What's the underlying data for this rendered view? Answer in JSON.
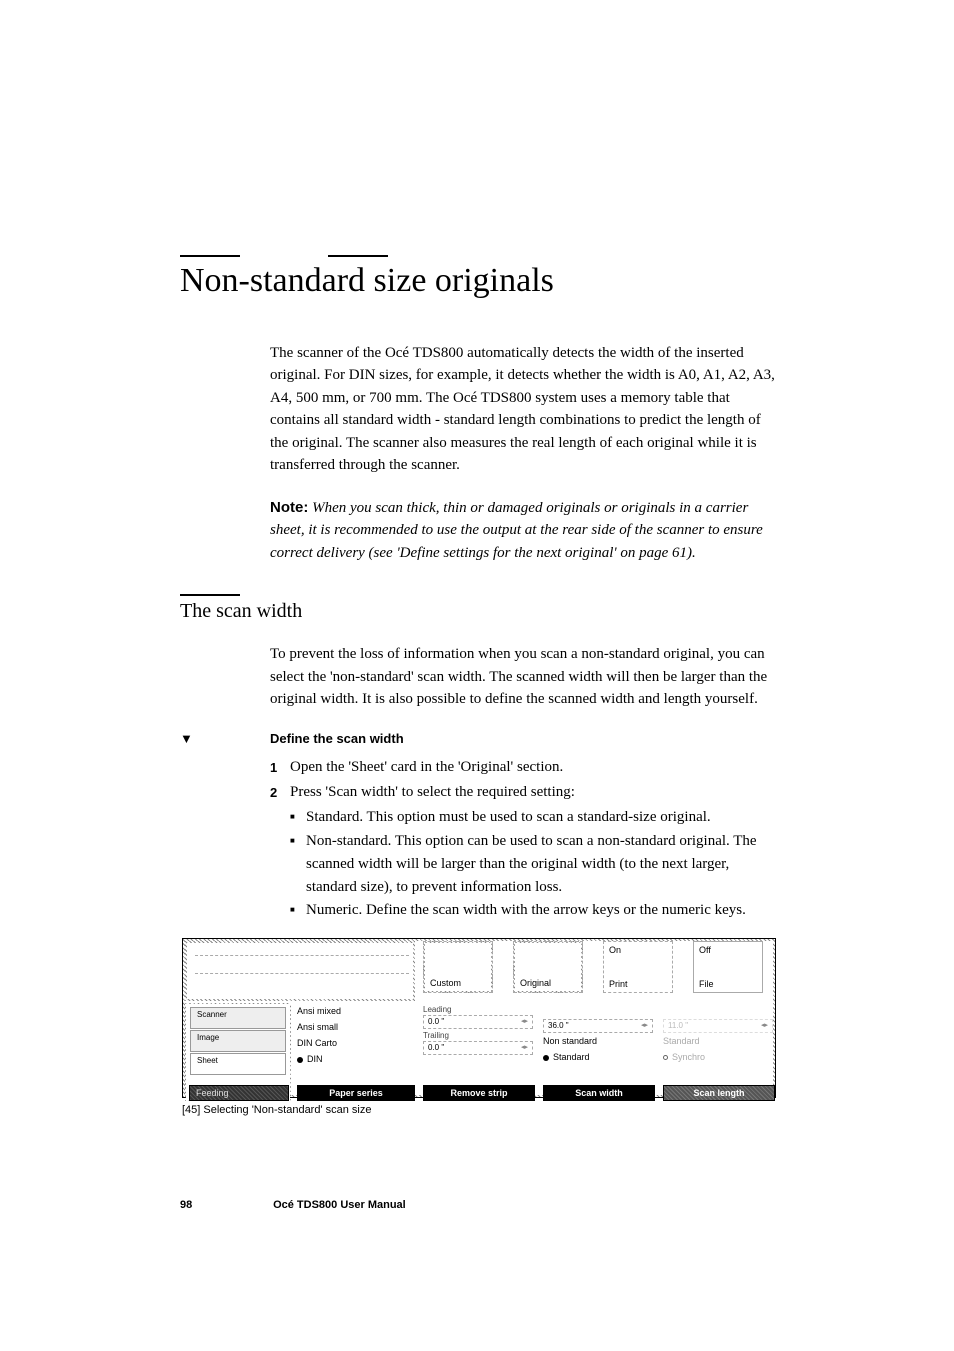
{
  "title": "Non-standard size originals",
  "intro": "The scanner of the Océ TDS800 automatically detects the width of the inserted original. For DIN sizes, for example, it detects whether the width is A0, A1, A2, A3, A4, 500 mm, or 700 mm. The Océ TDS800 system uses a memory table that contains all standard width - standard length combinations to predict the length of the original. The scanner also measures the real length of each original while it is transferred through the scanner.",
  "note_label": "Note:",
  "note_text": " When you scan thick, thin or damaged originals or originals in a carrier sheet, it is recommended to use the output at the rear side of the scanner to ensure correct delivery (see 'Define settings for the next original' on page 61).",
  "subsection_title": "The scan width",
  "subsection_intro": "To prevent the loss of information when you scan a non-standard original, you can select the 'non-standard' scan width. The scanned width will then be larger than the original width. It is also possible to define the scanned width and length yourself.",
  "procedure_marker": "▼",
  "procedure_title": "Define the scan width",
  "steps": [
    {
      "num": "1",
      "text": "Open the 'Sheet' card in the 'Original' section."
    },
    {
      "num": "2",
      "text": "Press 'Scan width' to select the required setting:"
    }
  ],
  "bullets": [
    "Standard. This option must be used to scan a standard-size original.",
    "Non-standard. This option can be used to scan a non-standard original. The scanned width will be larger than the original width (to the next larger, standard size), to prevent information loss.",
    "Numeric. Define the scan width with the arrow keys or the numeric keys."
  ],
  "figure": {
    "top_tabs": [
      {
        "top": "",
        "bottom": "Custom"
      },
      {
        "top": "",
        "bottom": "Original"
      },
      {
        "top": "On",
        "bottom": "Print"
      },
      {
        "top": "Off",
        "bottom": "File"
      }
    ],
    "side_tabs": [
      "Scanner",
      "Image",
      "Sheet",
      "Feeding"
    ],
    "side_active_index": 2,
    "col1": {
      "options": [
        "Ansi mixed",
        "Ansi small",
        "DIN Carto",
        "DIN"
      ],
      "selected_index": 3,
      "footer": "Paper series"
    },
    "col2": {
      "label1": "Leading",
      "val1": "0.0 \"",
      "label2": "Trailing",
      "val2": "0.0 \"",
      "footer": "Remove strip"
    },
    "col3": {
      "val1": "36.0 \"",
      "opt_ns": "Non standard",
      "opt_std": "Standard",
      "selected": "Standard",
      "footer": "Scan width"
    },
    "col4": {
      "val1": "11.0 \"",
      "opt_std": "Standard",
      "opt_syn": "Synchro",
      "selected": "Synchro",
      "footer": "Scan length"
    },
    "bottom_left_tab": "Feeding"
  },
  "caption": "[45] Selecting 'Non-standard' scan size",
  "footer_page": "98",
  "footer_text": "Océ TDS800 User Manual"
}
